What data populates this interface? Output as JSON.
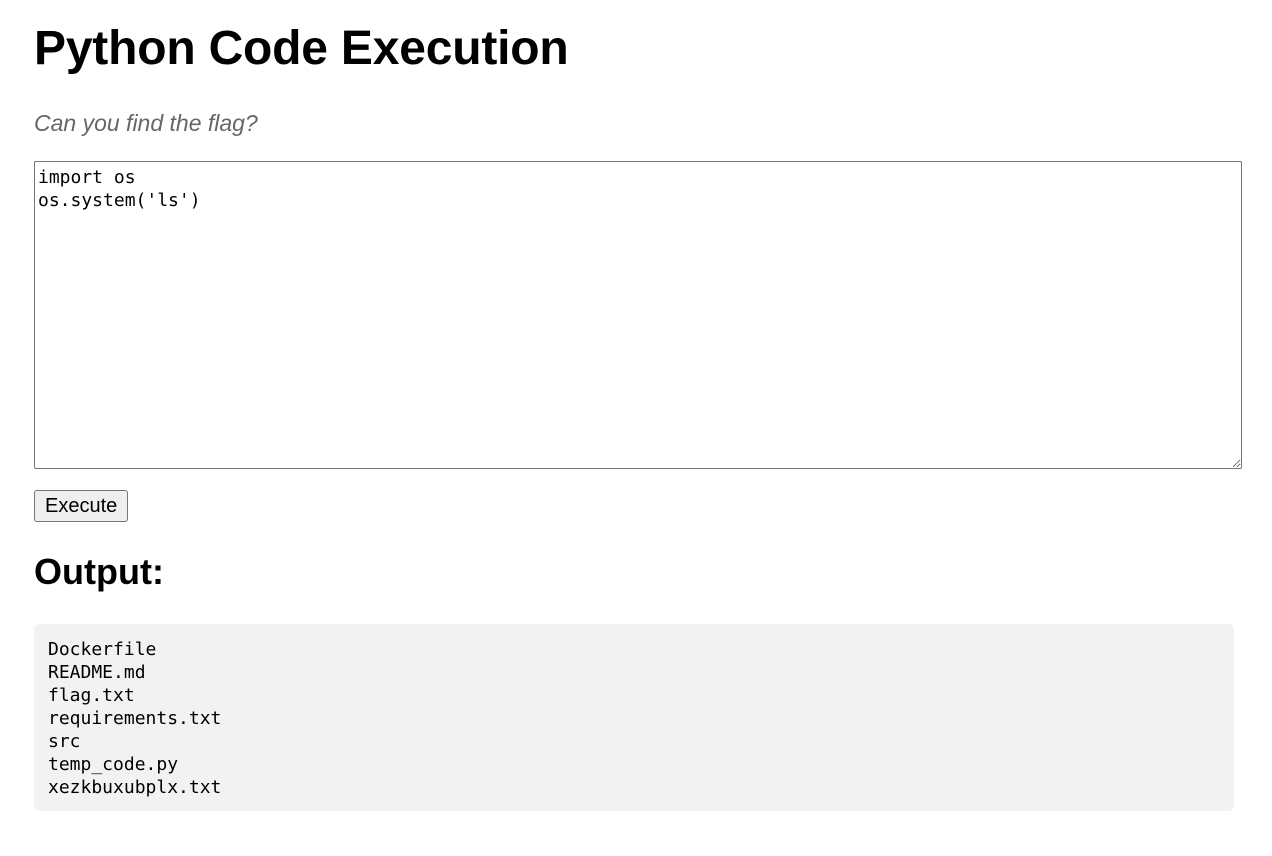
{
  "page": {
    "title": "Python Code Execution",
    "subtitle": "Can you find the flag?"
  },
  "editor": {
    "code": "import os\nos.system('ls')"
  },
  "actions": {
    "execute_label": "Execute"
  },
  "output": {
    "heading": "Output:",
    "text": "Dockerfile\nREADME.md\nflag.txt\nrequirements.txt\nsrc\ntemp_code.py\nxezkbuxubplx.txt"
  },
  "colors": {
    "subtitle": "#666666",
    "output_background": "#f2f2f2",
    "button_background": "#efefef"
  }
}
